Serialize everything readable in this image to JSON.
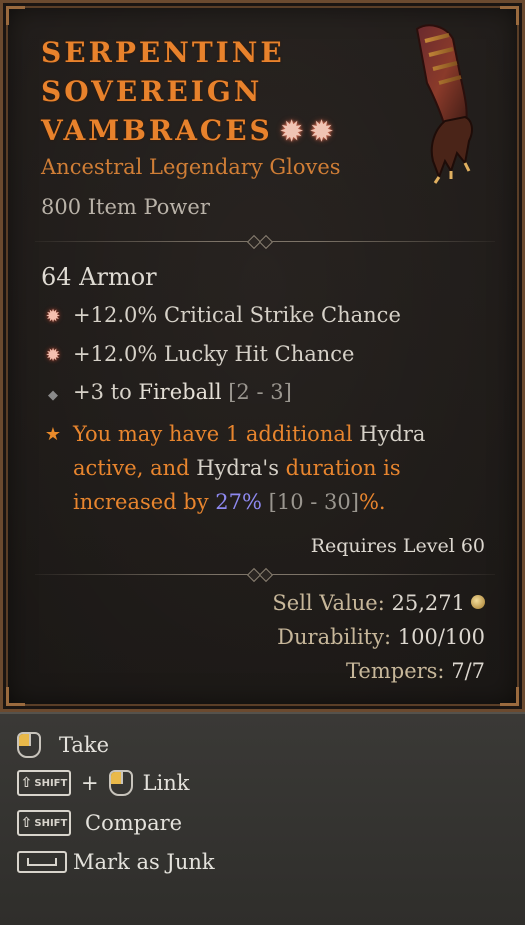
{
  "item": {
    "title_lines": [
      "SERPENTINE",
      "SOVEREIGN",
      "VAMBRACES"
    ],
    "rarity_type": "Ancestral Legendary Gloves",
    "item_power": "800 Item Power",
    "armor": "64 Armor",
    "affixes": [
      {
        "icon": "greater-affix-icon",
        "text": "+12.0% Critical Strike Chance"
      },
      {
        "icon": "greater-affix-icon",
        "text": "+12.0% Lucky Hit Chance"
      },
      {
        "icon": "diamond-bullet-icon",
        "prefix": "+3 to ",
        "skill": "Fireball",
        "range": "[2 - 3]"
      }
    ],
    "legendary_power": {
      "icon": "legendary-star-icon",
      "p1": "You may have 1 additional ",
      "w1": "Hydra",
      "p2": "active, and ",
      "w2": "Hydra's",
      "p3": " duration is",
      "p4": "increased by ",
      "value": "27%",
      "range": "[10 - 30]",
      "p5": "%."
    },
    "requires_level": "Requires Level 60",
    "sell_value_label": "Sell Value:",
    "sell_value": "25,271",
    "durability_label": "Durability:",
    "durability": "100/100",
    "tempers_label": "Tempers:",
    "tempers": "7/7"
  },
  "controls": {
    "take": "Take",
    "link": "Link",
    "compare": "Compare",
    "junk": "Mark as Junk",
    "shift_key": "SHIFT",
    "plus": "+"
  },
  "colors": {
    "legendary": "#e8822c",
    "value_highlight": "#8e89f0",
    "border": "#6b4a2f"
  }
}
